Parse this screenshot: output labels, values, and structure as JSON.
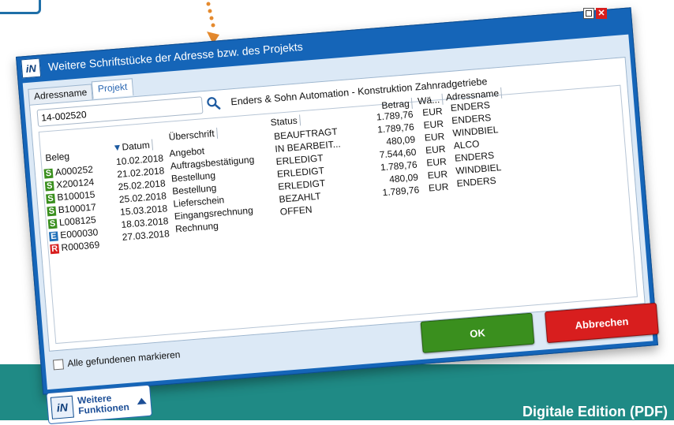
{
  "window": {
    "title": "Weitere Schriftstücke der Adresse bzw. des Projekts",
    "close_glyph": "✕"
  },
  "tabs": [
    {
      "label": "Adressname",
      "active": false
    },
    {
      "label": "Projekt",
      "active": true
    }
  ],
  "search": {
    "value": "14-002520"
  },
  "project_name": "Enders & Sohn Automation - Konstruktion Zahnradgetriebe",
  "table": {
    "columns": [
      "Beleg",
      "Datum",
      "Überschrift",
      "Status",
      "Betrag",
      "Wä...",
      "Adressname"
    ],
    "rows": [
      {
        "type": "S",
        "beleg": "A000252",
        "datum": "10.02.2018",
        "ueberschrift": "Angebot",
        "status": "BEAUFTRAGT",
        "betrag": "1.789,76",
        "waehrung": "EUR",
        "adressname": "ENDERS"
      },
      {
        "type": "S",
        "beleg": "X200124",
        "datum": "21.02.2018",
        "ueberschrift": "Auftragsbestätigung",
        "status": "IN BEARBEIT...",
        "betrag": "1.789,76",
        "waehrung": "EUR",
        "adressname": "ENDERS"
      },
      {
        "type": "S",
        "beleg": "B100015",
        "datum": "25.02.2018",
        "ueberschrift": "Bestellung",
        "status": "ERLEDIGT",
        "betrag": "480,09",
        "waehrung": "EUR",
        "adressname": "WINDBIEL"
      },
      {
        "type": "S",
        "beleg": "B100017",
        "datum": "25.02.2018",
        "ueberschrift": "Bestellung",
        "status": "ERLEDIGT",
        "betrag": "7.544,60",
        "waehrung": "EUR",
        "adressname": "ALCO"
      },
      {
        "type": "S",
        "beleg": "L008125",
        "datum": "15.03.2018",
        "ueberschrift": "Lieferschein",
        "status": "ERLEDIGT",
        "betrag": "1.789,76",
        "waehrung": "EUR",
        "adressname": "ENDERS"
      },
      {
        "type": "E",
        "beleg": "E000030",
        "datum": "18.03.2018",
        "ueberschrift": "Eingangsrechnung",
        "status": "BEZAHLT",
        "betrag": "480,09",
        "waehrung": "EUR",
        "adressname": "WINDBIEL"
      },
      {
        "type": "R",
        "beleg": "R000369",
        "datum": "27.03.2018",
        "ueberschrift": "Rechnung",
        "status": "OFFEN",
        "betrag": "1.789,76",
        "waehrung": "EUR",
        "adressname": "ENDERS"
      }
    ]
  },
  "checkbox_label": "Alle gefundenen markieren",
  "buttons": {
    "ok": "OK",
    "cancel": "Abbrechen",
    "more_line1": "Weitere",
    "more_line2": "Funktionen"
  },
  "footer": "Digitale Edition (PDF)",
  "colors": {
    "S": "#3a8f1e",
    "E": "#1f6fb8",
    "R": "#d81e1e",
    "footer": "#1f8a85"
  }
}
